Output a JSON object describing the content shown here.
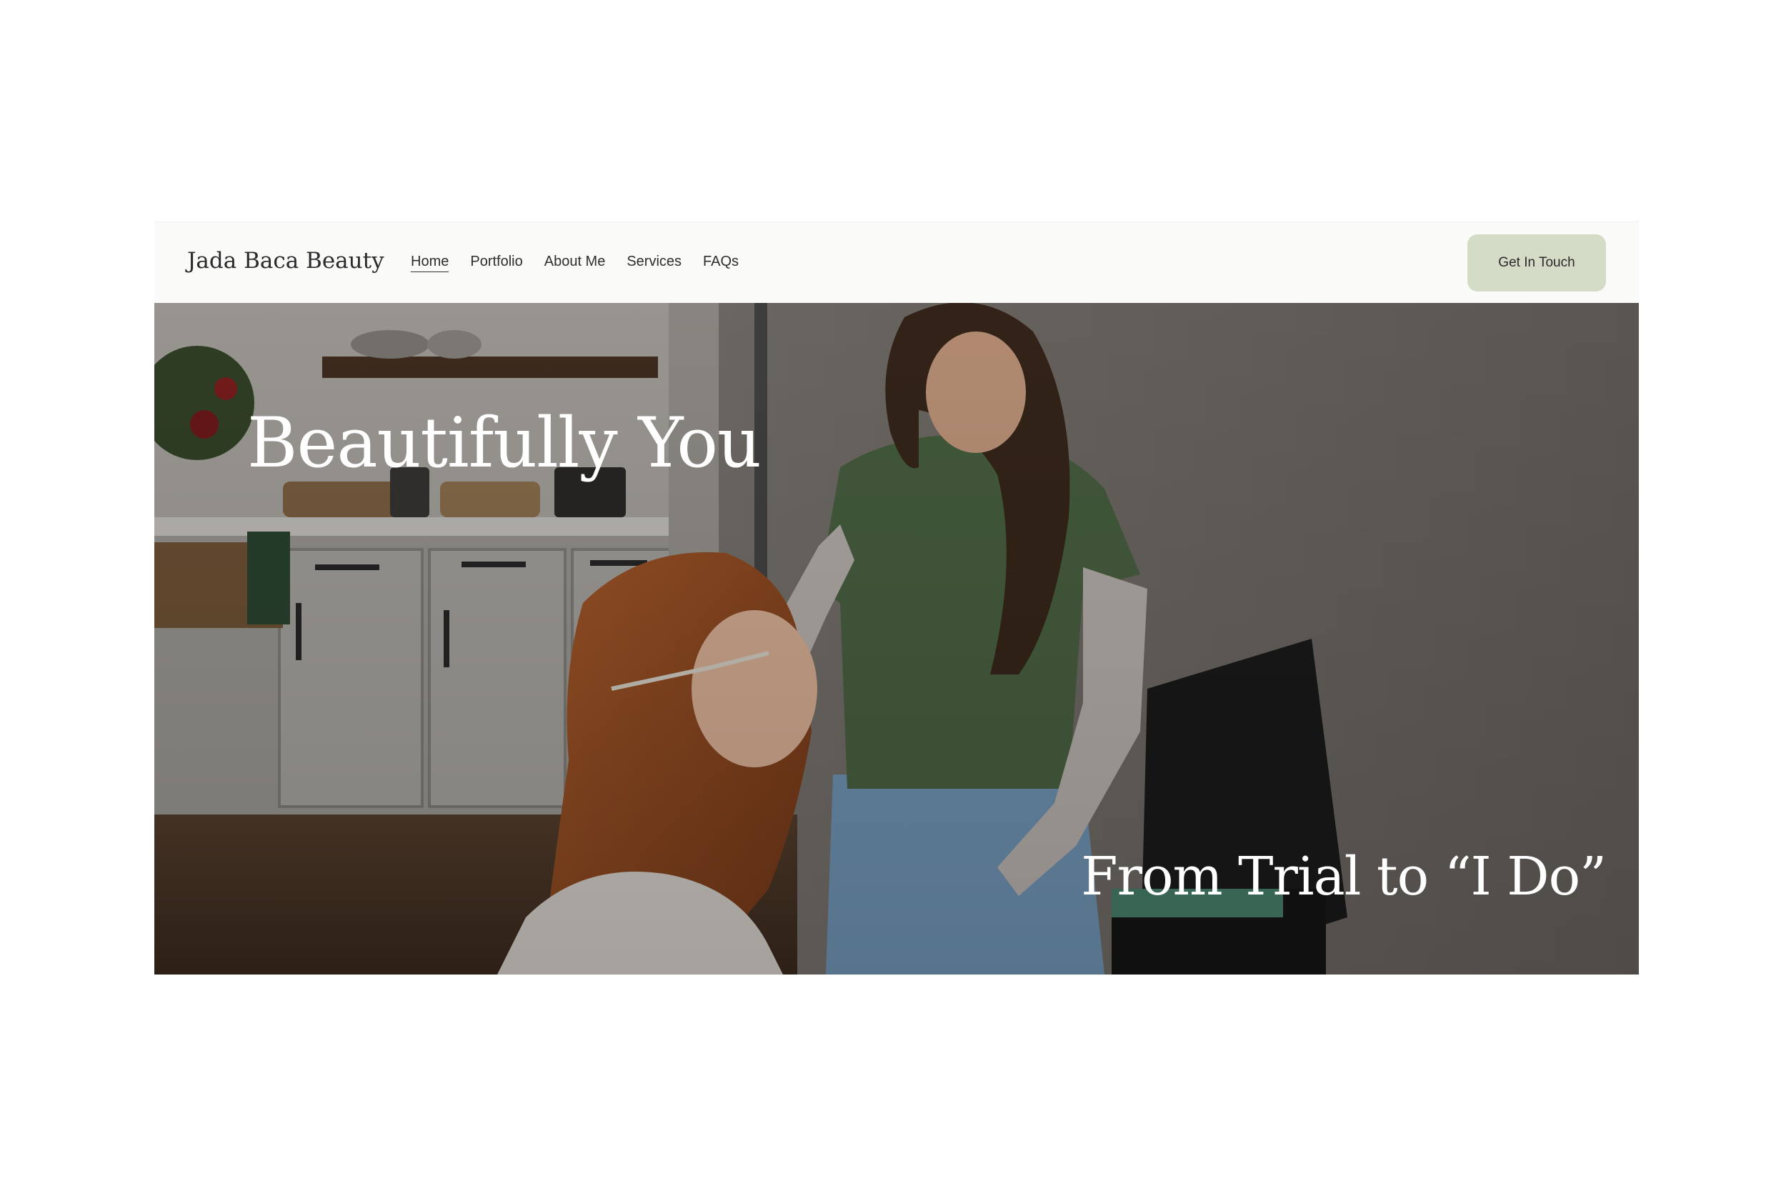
{
  "header": {
    "brand": "Jada Baca Beauty",
    "nav": [
      {
        "label": "Home",
        "active": true
      },
      {
        "label": "Portfolio",
        "active": false
      },
      {
        "label": "About Me",
        "active": false
      },
      {
        "label": "Services",
        "active": false
      },
      {
        "label": "FAQs",
        "active": false
      }
    ],
    "cta_label": "Get In Touch"
  },
  "hero": {
    "heading": "Beautifully You",
    "tagline": "From Trial to “I Do”",
    "image_description": "makeup artist styling a bride's hair in a kitchen"
  },
  "colors": {
    "cta_background": "#d4dbc6",
    "header_background": "#fafaf9",
    "text_dark": "#2e2e2e",
    "hero_text": "#ffffff"
  }
}
